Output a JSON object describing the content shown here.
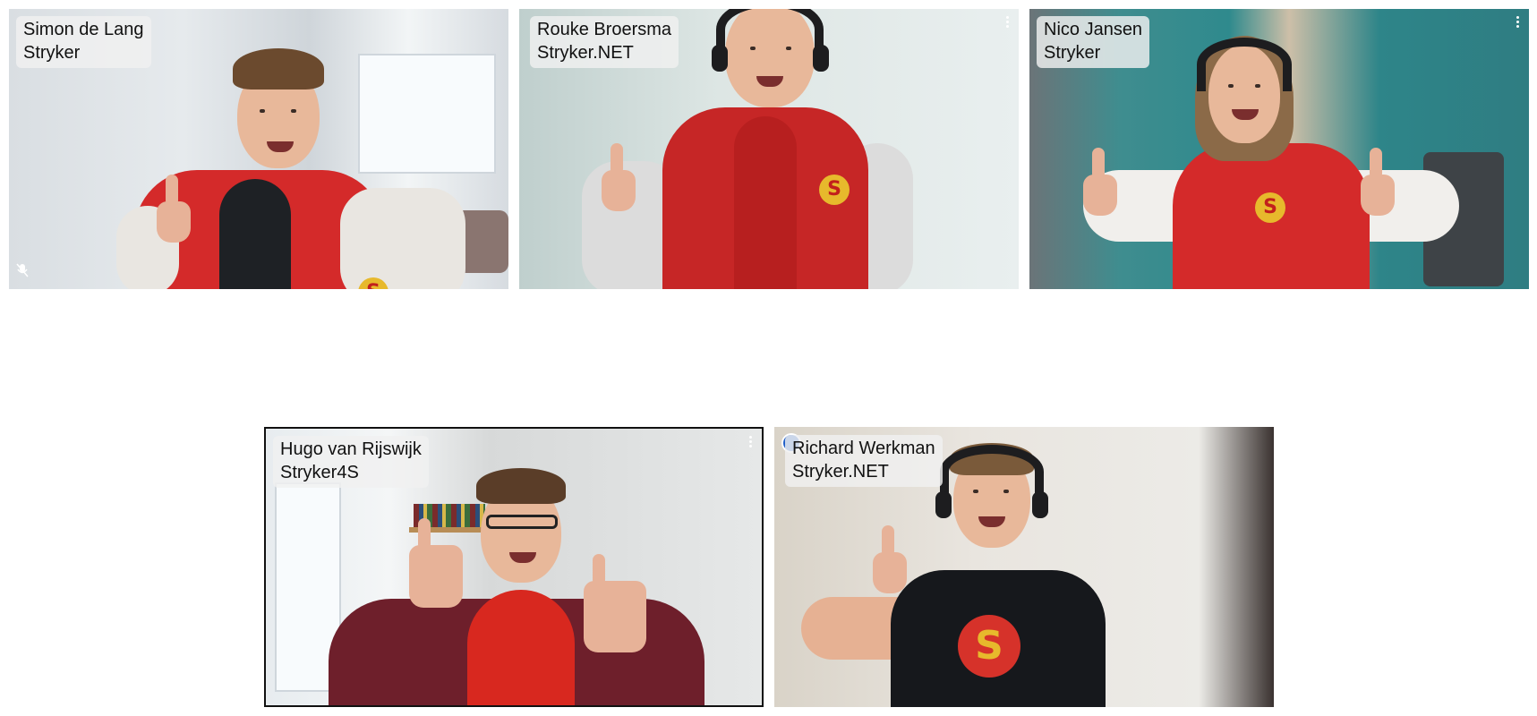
{
  "participants": [
    {
      "name": "Simon de Lang",
      "org": "Stryker",
      "muted": true
    },
    {
      "name": "Rouke Broersma",
      "org": "Stryker.NET"
    },
    {
      "name": "Nico Jansen",
      "org": "Stryker"
    },
    {
      "name": "Hugo van Rijswijk",
      "org": "Stryker4S"
    },
    {
      "name": "Richard Werkman",
      "org": "Stryker.NET",
      "speaking": true
    }
  ],
  "icons": {
    "more": "more-options-icon",
    "mic_off": "mic-off-icon",
    "speaking": "speaking-indicator-icon"
  },
  "colors": {
    "label_bg": "#f0f0f0",
    "speaking_accent": "#1f5ec8",
    "jacket_red": "#d42a2a"
  }
}
